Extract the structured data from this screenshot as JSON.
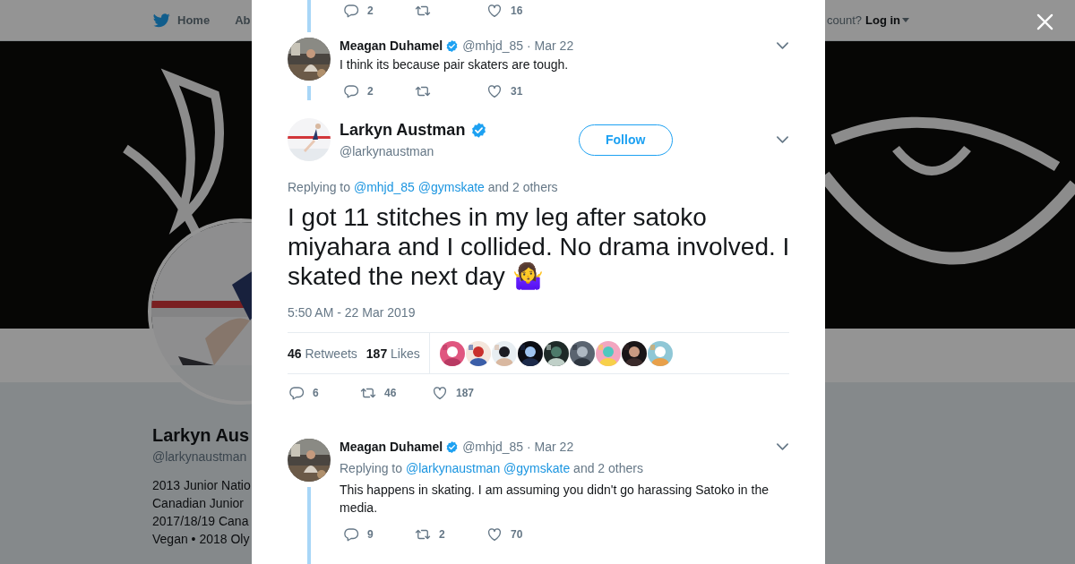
{
  "top_nav": {
    "items": [
      {
        "label": "Home"
      },
      {
        "label": "Ab"
      }
    ],
    "account_prompt": "count?",
    "login": "Log in"
  },
  "profile": {
    "name": "Larkyn Aus",
    "handle": "@larkynaustman",
    "bio": [
      "2013 Junior Natio",
      "Canadian Junior",
      "2017/18/19 Cana",
      "Vegan • 2018 Oly"
    ]
  },
  "conversation": {
    "parent_actions": {
      "replies": "2",
      "likes": "16"
    },
    "tweet_above": {
      "name": "Meagan Duhamel",
      "verified": true,
      "handle": "@mhjd_85",
      "date": "· Mar 22",
      "text": "I think its because pair skaters are tough.",
      "replies": "2",
      "likes": "31"
    },
    "main_tweet": {
      "name": "Larkyn Austman",
      "verified": true,
      "handle": "@larkynaustman",
      "follow": "Follow",
      "replying_prefix": "Replying to",
      "replying_to": [
        "@mhjd_85",
        "@gymskate"
      ],
      "replying_suffix": "and 2 others",
      "text": "I got 11 stitches in my leg after satoko miyahara and I collided. No drama involved. I skated the next day 🤷‍♀️",
      "timestamp": "5:50 AM - 22 Mar 2019",
      "retweet_count": "46",
      "retweet_label": "Retweets",
      "like_count": "187",
      "like_label": "Likes",
      "replies": "6",
      "retweets": "46",
      "likes": "187"
    },
    "reply_below": {
      "name": "Meagan Duhamel",
      "verified": true,
      "handle": "@mhjd_85",
      "date": "· Mar 22",
      "replying_prefix": "Replying to",
      "replying_to": [
        "@larkynaustman",
        "@gymskate"
      ],
      "replying_suffix": "and 2 others",
      "text": "This happens in skating. I am assuming you didn't go harassing Satoko in the media.",
      "replies": "9",
      "retweets": "2",
      "likes": "70"
    }
  }
}
